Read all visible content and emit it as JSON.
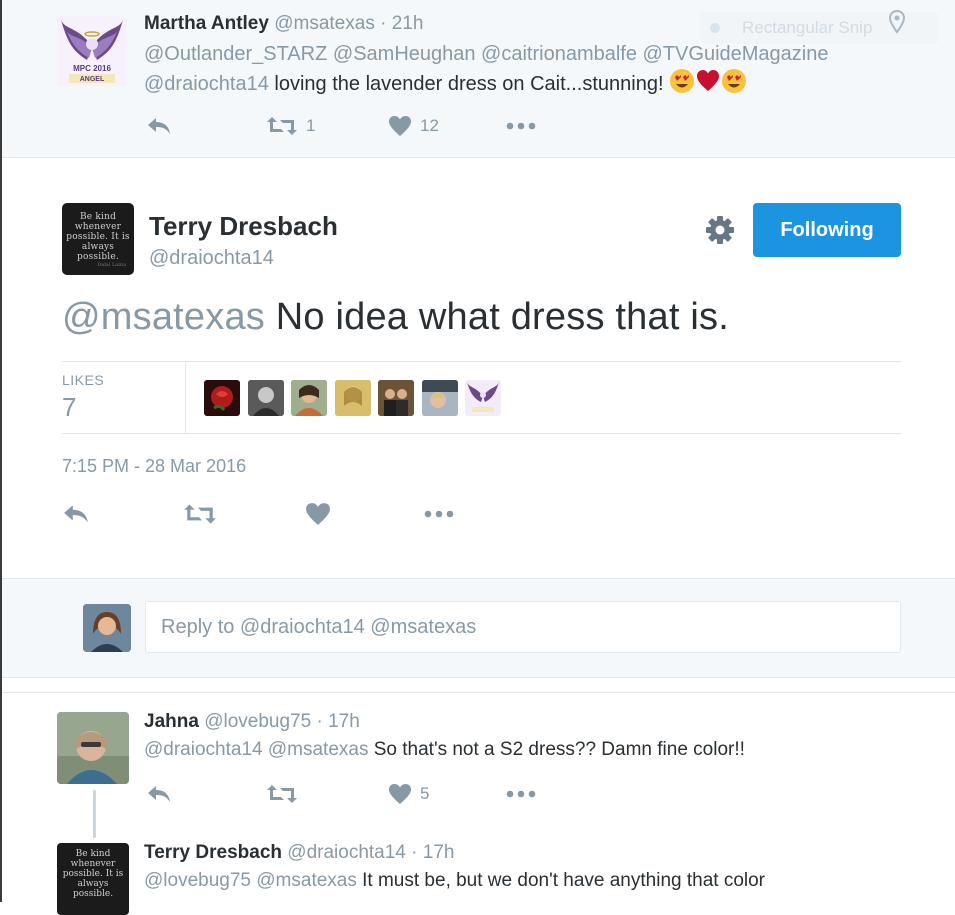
{
  "top_tweet": {
    "name": "Martha Antley",
    "handle": "@msatexas",
    "dot": "·",
    "time": "21h",
    "line1": "@Outlander_STARZ @SamHeughan @caitrionambalfe @TVGuideMagazine",
    "mention2": "@draiochta14",
    "text": "loving the lavender dress on Cait...stunning!",
    "retweets": "1",
    "likes": "12",
    "avatar_text": "MPC 2016",
    "avatar_sub": "ANGEL"
  },
  "snip_overlay": {
    "label": "Rectangular Snip"
  },
  "main_tweet": {
    "name": "Terry Dresbach",
    "handle": "@draiochta14",
    "follow_label": "Following",
    "mention": "@msatexas",
    "text": "No idea what dress that is.",
    "likes_label": "LIKES",
    "likes_count": "7",
    "timestamp": "7:15 PM - 28 Mar 2016",
    "avatar_quote": "Be kind whenever possible. It is always possible.",
    "avatar_sig": "Dalai Lama"
  },
  "liker_avatars": [
    {
      "name": "rose",
      "color": "#b01c1c"
    },
    {
      "name": "bw-portrait",
      "color": "#6e6e6e"
    },
    {
      "name": "scarf-woman",
      "color": "#8a6e4c"
    },
    {
      "name": "gold-portrait",
      "color": "#c9a24a"
    },
    {
      "name": "group-photo",
      "color": "#4a3b2c"
    },
    {
      "name": "car-selfie",
      "color": "#7c8896"
    },
    {
      "name": "angel",
      "color": "#e8def1"
    }
  ],
  "reply": {
    "placeholder": "Reply to @draiochta14 @msatexas"
  },
  "jahna_tweet": {
    "name": "Jahna",
    "handle": "@lovebug75",
    "dot": "·",
    "time": "17h",
    "mentions": "@draiochta14 @msatexas",
    "text": "So that's not a S2 dress?? Damn fine color!!",
    "likes": "5"
  },
  "terry_reply": {
    "name": "Terry Dresbach",
    "handle": "@draiochta14",
    "dot": "·",
    "time": "17h",
    "mentions": "@lovebug75 @msatexas",
    "text": "It must be, but we don't have anything that color"
  },
  "colors": {
    "accent": "#1b95e0",
    "muted": "#8899a6",
    "text": "#292f33",
    "panel": "#f5f8fa",
    "border": "#e1e8ed"
  }
}
